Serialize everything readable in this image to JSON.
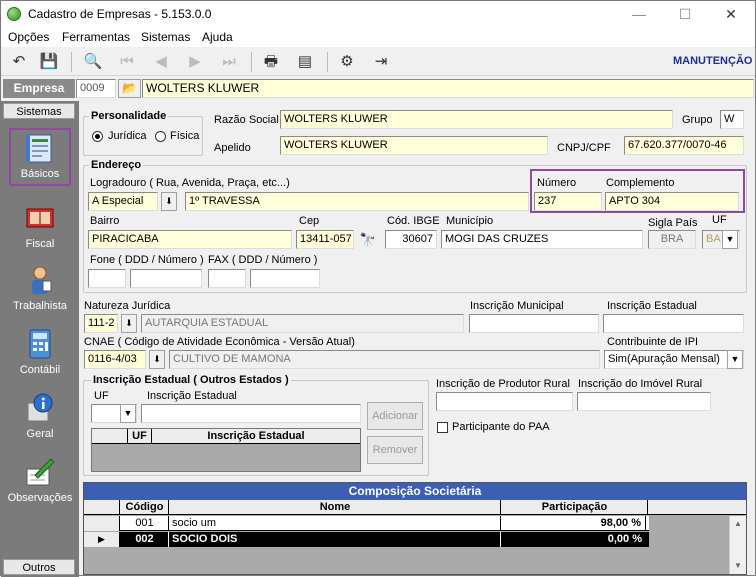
{
  "window": {
    "title": "Cadastro de Empresas - 5.153.0.0"
  },
  "menu": {
    "items": [
      "Opções",
      "Ferramentas",
      "Sistemas",
      "Ajuda"
    ]
  },
  "toolbar": {
    "mode": "MANUTENÇÃO"
  },
  "empresa": {
    "label": "Empresa",
    "code": "0009",
    "name": "WOLTERS KLUWER"
  },
  "sidebar": {
    "header_top": "Sistemas",
    "header_bottom": "Outros",
    "items": [
      "Básicos",
      "Fiscal",
      "Trabalhista",
      "Contábil",
      "Geral",
      "Observações"
    ]
  },
  "personalidade": {
    "title": "Personalidade",
    "juridica": "Jurídica",
    "fisica": "Física"
  },
  "razao": {
    "label": "Razão Social",
    "value": "WOLTERS KLUWER",
    "grupo_label": "Grupo",
    "grupo_value": "W"
  },
  "apelido": {
    "label": "Apelido",
    "value": "WOLTERS KLUWER",
    "cnpj_label": "CNPJ/CPF",
    "cnpj_value": "67.620.377/0070-46"
  },
  "endereco": {
    "title": "Endereço",
    "logradouro_label": "Logradouro ( Rua, Avenida, Praça, etc...)",
    "tipo": "A Especial",
    "logradouro": "1º TRAVESSA",
    "numero_label": "Número",
    "numero": "237",
    "complemento_label": "Complemento",
    "complemento": "APTO 304",
    "bairro_label": "Bairro",
    "bairro": "PIRACICABA",
    "cep_label": "Cep",
    "cep": "13411-057",
    "ibge_label": "Cód. IBGE",
    "ibge": "30607",
    "municipio_label": "Município",
    "municipio": "MOGI DAS CRUZES",
    "siglapais_label": "Sigla País",
    "siglapais": "BRA",
    "uf_label": "UF",
    "uf": "BA",
    "fone_label": "Fone ( DDD / Número )",
    "fax_label": "FAX ( DDD / Número )"
  },
  "natureza": {
    "label": "Natureza Jurídica",
    "code": "111-2",
    "desc": "AUTARQUIA ESTADUAL",
    "insc_mun_label": "Inscrição Municipal",
    "insc_est_label": "Inscrição Estadual"
  },
  "cnae": {
    "label": "CNAE ( Código de Atividade Econômica - Versão Atual)",
    "code": "0116-4/03",
    "desc": "CULTIVO DE MAMONA",
    "ipi_label": "Contribuinte de IPI",
    "ipi_value": "Sim(Apuração Mensal)"
  },
  "outros_estados": {
    "title": "Inscrição Estadual ( Outros Estados )",
    "uf_label": "UF",
    "ie_label": "Inscrição Estadual",
    "add": "Adicionar",
    "remove": "Remover",
    "col_uf": "UF",
    "col_ie": "Inscrição Estadual"
  },
  "produtor": {
    "label": "Inscrição de Produtor Rural",
    "imovel_label": "Inscrição do Imóvel Rural",
    "paa_label": "Participante do PAA"
  },
  "composicao": {
    "title": "Composição Societária",
    "headers": [
      "Código",
      "Nome",
      "Participação"
    ],
    "rows": [
      {
        "codigo": "001",
        "nome": "socio um",
        "participacao": "98,00 %"
      },
      {
        "codigo": "002",
        "nome": "SOCIO DOIS",
        "participacao": "0,00 %"
      }
    ]
  },
  "colors": {
    "highlight": "#8e4a9c",
    "input_bg": "#ffffd9",
    "sidebar": "#7b7b7b",
    "grid_header": "#000000",
    "mode_color": "#1f2f8f"
  }
}
